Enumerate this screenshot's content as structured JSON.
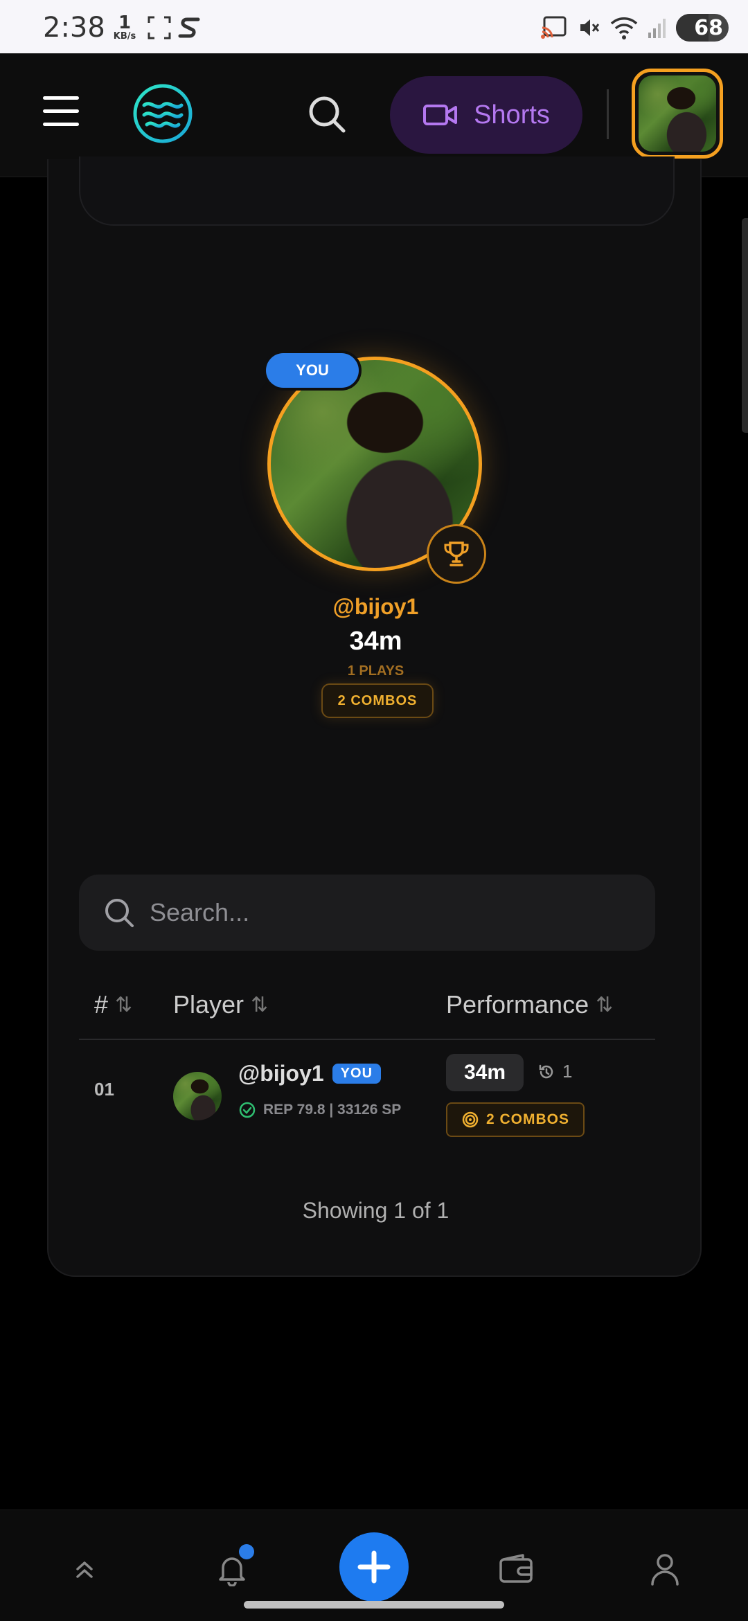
{
  "status_bar": {
    "time": "2:38",
    "net_speed": "1",
    "net_unit": "KB/s",
    "battery": "68"
  },
  "header": {
    "menu_icon": "hamburger-icon",
    "logo_icon": "waves-logo-icon",
    "search_icon": "search-icon",
    "shorts_label": "Shorts",
    "shorts_icon": "video-camera-icon",
    "accent": "#f5a020"
  },
  "hero": {
    "you_badge": "YOU",
    "username": "@bijoy1",
    "time": "34m",
    "plays": "1 PLAYS",
    "combos": "2 COMBOS",
    "trophy_icon": "trophy-icon"
  },
  "search": {
    "placeholder": "Search..."
  },
  "table": {
    "columns": [
      {
        "label": "#",
        "sort_icon": "sort-icon"
      },
      {
        "label": "Player",
        "sort_icon": "sort-icon"
      },
      {
        "label": "Performance",
        "sort_icon": "sort-icon"
      }
    ],
    "rows": [
      {
        "rank": "01",
        "username": "@bijoy1",
        "you_badge": "YOU",
        "rep": "REP 79.8 | 33126 SP",
        "time": "34m",
        "replays": "1",
        "combos": "2 COMBOS"
      }
    ],
    "footer": "Showing 1 of 1"
  },
  "bottom_nav": {
    "items": [
      "chevrons-up-icon",
      "bell-icon",
      "plus-icon",
      "wallet-icon",
      "user-icon"
    ],
    "fab_color": "#1e7bf0"
  }
}
